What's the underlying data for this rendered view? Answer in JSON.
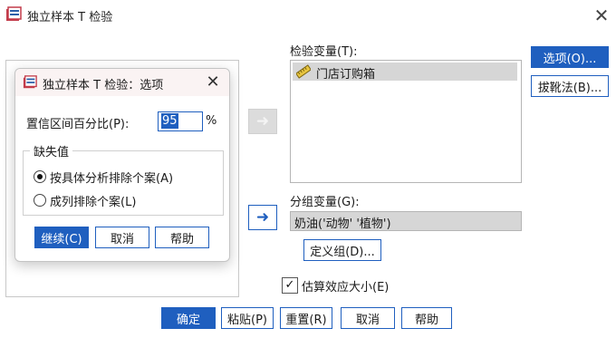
{
  "window": {
    "title": "独立样本 T 检验"
  },
  "test_variables": {
    "label": "检验变量(T):",
    "items": [
      "门店订购箱"
    ]
  },
  "grouping": {
    "label": "分组变量(G):",
    "value": "奶油('动物' '植物')",
    "define_button": "定义组(D)..."
  },
  "side_buttons": {
    "options": "选项(O)...",
    "bootstrap": "拔靴法(B)..."
  },
  "effect_size": {
    "label": "估算效应大小(E)",
    "checked": true,
    "check_mark": "✓"
  },
  "footer": {
    "ok": "确定",
    "paste": "粘贴(P)",
    "reset": "重置(R)",
    "cancel": "取消",
    "help": "帮助"
  },
  "options_dialog": {
    "title": "独立样本 T 检验：选项",
    "ci_label": "置信区间百分比(P):",
    "ci_value": "95",
    "ci_unit": "%",
    "missing_group_label": "缺失值",
    "radio_analysis": "按具体分析排除个案(A)",
    "radio_listwise": "成列排除个案(L)",
    "selected_radio": "analysis",
    "continue": "继续(C)",
    "cancel": "取消",
    "help": "帮助"
  },
  "colors": {
    "accent": "#1f5fbf",
    "selection": "#d6d6d6"
  },
  "icons": [
    "app-icon",
    "close-icon",
    "ruler-icon",
    "arrow-right-icon"
  ]
}
